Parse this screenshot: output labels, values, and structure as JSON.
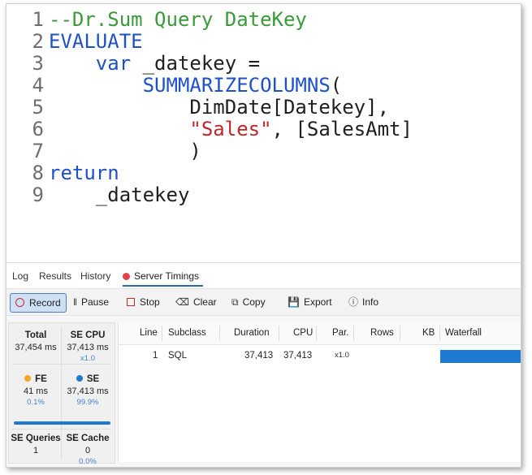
{
  "editor": {
    "lines": [
      {
        "n": "1",
        "parts": [
          {
            "t": "--Dr.Sum Query DateKey",
            "c": "comment"
          }
        ]
      },
      {
        "n": "2",
        "parts": [
          {
            "t": "EVALUATE",
            "c": "kw"
          }
        ]
      },
      {
        "n": "3",
        "parts": [
          {
            "t": "    ",
            "c": "txt"
          },
          {
            "t": "var",
            "c": "kw"
          },
          {
            "t": " _datekey =",
            "c": "txt"
          }
        ]
      },
      {
        "n": "4",
        "parts": [
          {
            "t": "        ",
            "c": "txt"
          },
          {
            "t": "SUMMARIZECOLUMNS",
            "c": "fn"
          },
          {
            "t": "(",
            "c": "txt"
          }
        ]
      },
      {
        "n": "5",
        "parts": [
          {
            "t": "            DimDate[Datekey],",
            "c": "txt"
          }
        ]
      },
      {
        "n": "6",
        "parts": [
          {
            "t": "            ",
            "c": "txt"
          },
          {
            "t": "\"Sales\"",
            "c": "str"
          },
          {
            "t": ", [SalesAmt]",
            "c": "txt"
          }
        ]
      },
      {
        "n": "7",
        "parts": [
          {
            "t": "            )",
            "c": "txt"
          }
        ]
      },
      {
        "n": "8",
        "parts": [
          {
            "t": "return",
            "c": "kw"
          }
        ]
      },
      {
        "n": "9",
        "parts": [
          {
            "t": "    _datekey",
            "c": "txt"
          }
        ]
      }
    ]
  },
  "tabs": {
    "log": "Log",
    "results": "Results",
    "history": "History",
    "server_timings": "Server Timings"
  },
  "toolbar": {
    "record": "Record",
    "pause": "Pause",
    "stop": "Stop",
    "clear": "Clear",
    "copy": "Copy",
    "export": "Export",
    "info": "Info"
  },
  "stats": {
    "total": {
      "title": "Total",
      "value": "37,454 ms"
    },
    "se_cpu": {
      "title": "SE CPU",
      "value": "37,413 ms",
      "sub": "x1.0"
    },
    "fe": {
      "title": "FE",
      "value": "41 ms",
      "sub": "0.1%"
    },
    "se": {
      "title": "SE",
      "value": "37,413 ms",
      "sub": "99.9%"
    },
    "se_queries": {
      "title": "SE Queries",
      "value": "1"
    },
    "se_cache": {
      "title": "SE Cache",
      "value": "0",
      "sub": "0.0%"
    }
  },
  "grid": {
    "headers": {
      "line": "Line",
      "subclass": "Subclass",
      "duration": "Duration",
      "cpu": "CPU",
      "par": "Par.",
      "rows": "Rows",
      "kb": "KB",
      "waterfall": "Waterfall"
    },
    "rows": [
      {
        "line": "1",
        "subclass": "SQL",
        "duration": "37,413",
        "cpu": "37,413",
        "par": "x1.0",
        "rows": "",
        "kb": ""
      }
    ]
  },
  "colors": {
    "accent": "#1e7bd4",
    "fe": "#f5a623",
    "record": "#c8282d"
  }
}
